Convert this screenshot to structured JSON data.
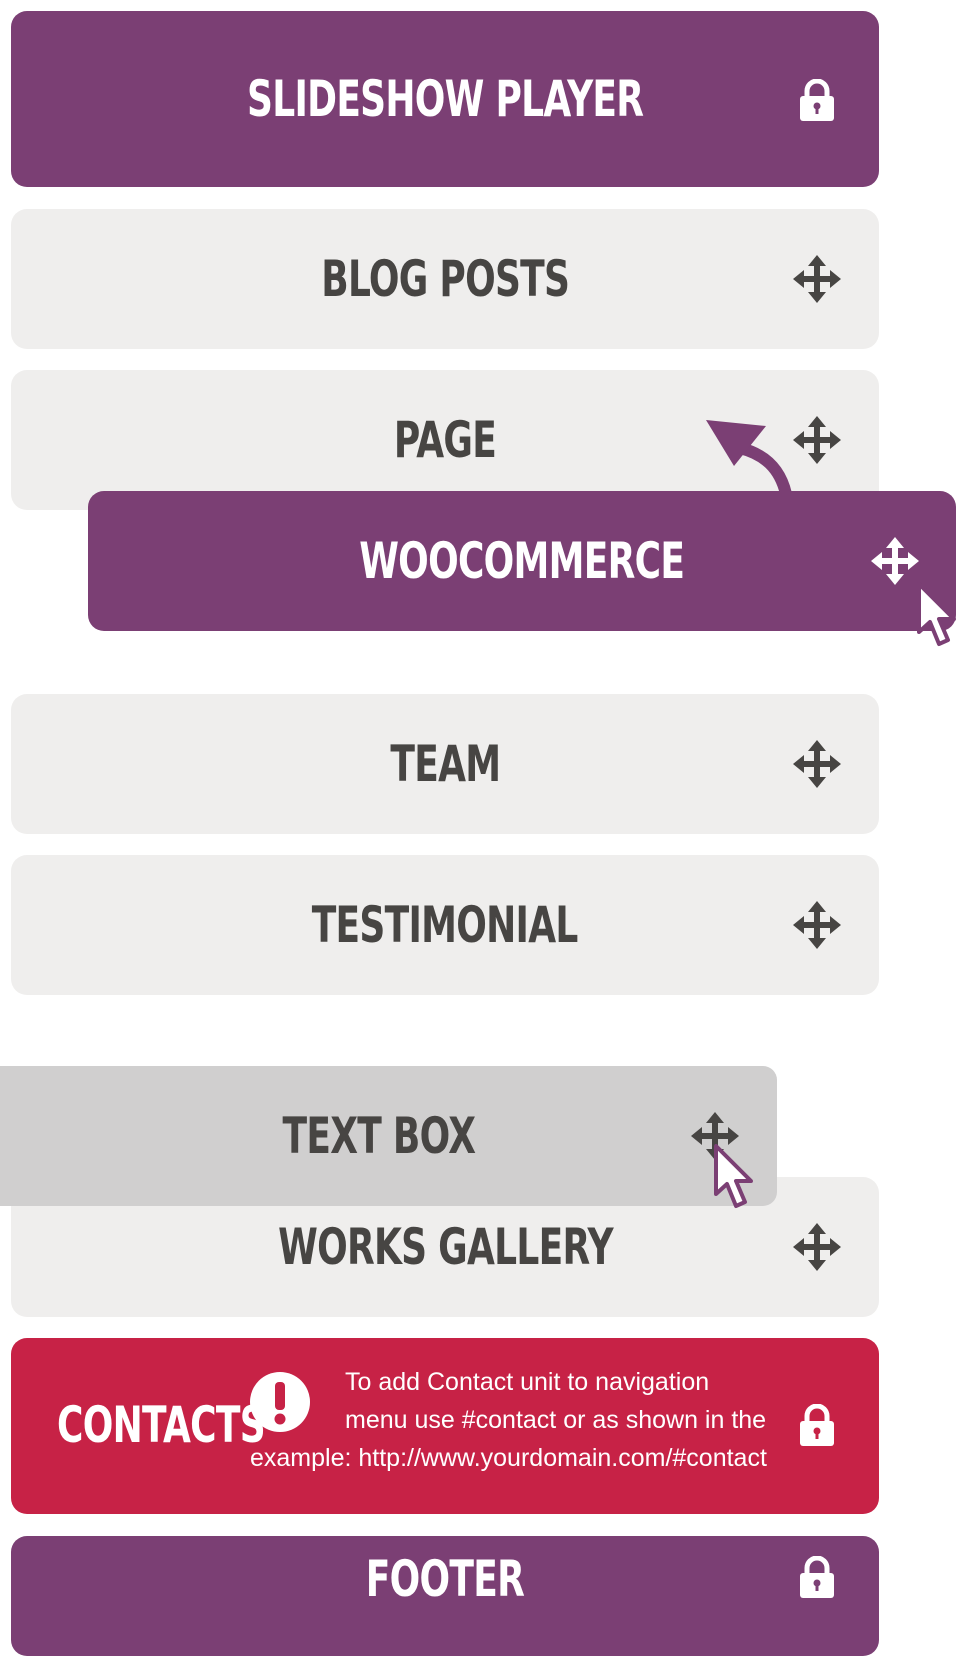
{
  "colors": {
    "purple": "#7b3f74",
    "light": "#efeeed",
    "grey": "#d0cfcf",
    "red": "#c72246",
    "text_dark": "#474543",
    "text_light": "#ffffff"
  },
  "sections": [
    {
      "label": "SLIDESHOW PLAYER",
      "state": "locked",
      "icon": "lock-icon"
    },
    {
      "label": "BLOG POSTS",
      "state": "movable",
      "icon": "move-icon"
    },
    {
      "label": "PAGE",
      "state": "movable",
      "icon": "move-icon"
    },
    {
      "label": "WOOCOMMERCE",
      "state": "dragging",
      "icon": "move-icon"
    },
    {
      "label": "TEAM",
      "state": "movable",
      "icon": "move-icon"
    },
    {
      "label": "TESTIMONIAL",
      "state": "movable",
      "icon": "move-icon"
    },
    {
      "label": "TEXT BOX",
      "state": "dragging",
      "icon": "move-icon"
    },
    {
      "label": "WORKS GALLERY",
      "state": "movable",
      "icon": "move-icon"
    },
    {
      "label": "CONTACTS",
      "state": "locked",
      "icon": "lock-icon"
    },
    {
      "label": "FOOTER",
      "state": "locked",
      "icon": "lock-icon"
    }
  ],
  "contacts_note": {
    "line1": "To add Contact unit to navigation",
    "line2": "menu use #contact or as shown in the",
    "line3": "example: http://www.yourdomain.com/#contact",
    "icon": "alert-icon"
  }
}
